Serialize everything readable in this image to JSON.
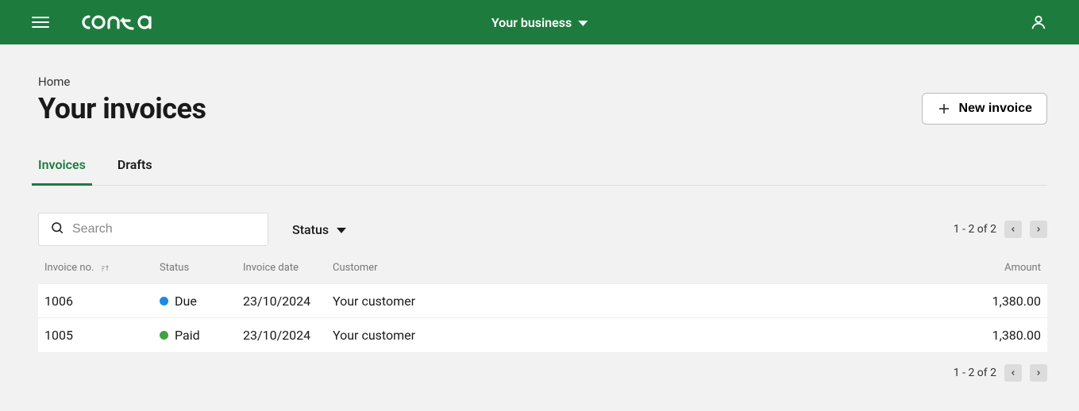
{
  "colors": {
    "brand_green": "#1E7B3E",
    "status_due": "#1E88E5",
    "status_paid": "#43A047"
  },
  "header": {
    "business_label": "Your business"
  },
  "breadcrumb": {
    "home": "Home"
  },
  "page_title": "Your invoices",
  "actions": {
    "new_invoice": "New invoice"
  },
  "tabs": [
    {
      "label": "Invoices",
      "active": true
    },
    {
      "label": "Drafts",
      "active": false
    }
  ],
  "toolbar": {
    "search_placeholder": "Search",
    "status_label": "Status"
  },
  "pager": {
    "text": "1 - 2 of 2"
  },
  "table": {
    "headers": {
      "invoice_no": "Invoice no.",
      "status": "Status",
      "invoice_date": "Invoice date",
      "customer": "Customer",
      "amount": "Amount"
    },
    "rows": [
      {
        "invoice_no": "1006",
        "status": "Due",
        "status_color": "#1E88E5",
        "invoice_date": "23/10/2024",
        "customer": "Your customer",
        "amount": "1,380.00"
      },
      {
        "invoice_no": "1005",
        "status": "Paid",
        "status_color": "#43A047",
        "invoice_date": "23/10/2024",
        "customer": "Your customer",
        "amount": "1,380.00"
      }
    ]
  }
}
